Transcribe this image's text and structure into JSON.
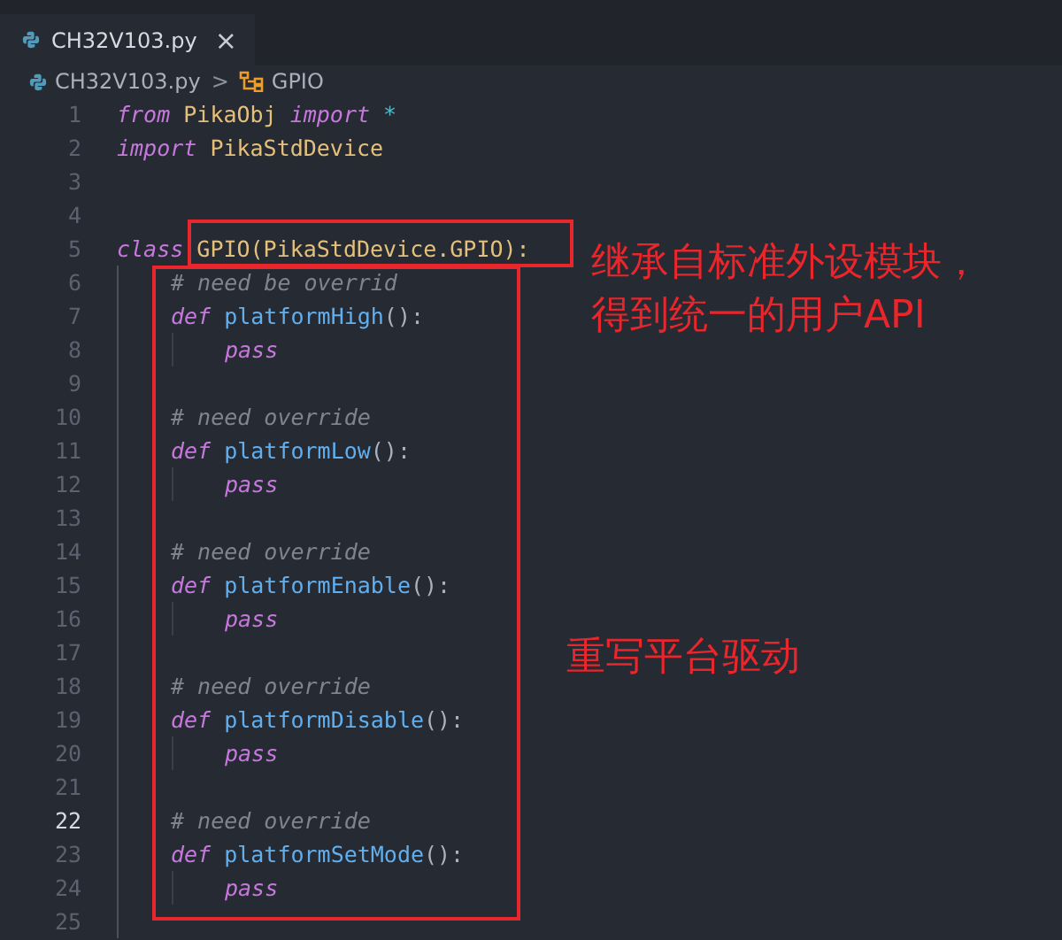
{
  "tab": {
    "label": "CH32V103.py",
    "close": "×",
    "selected": true
  },
  "breadcrumb": {
    "file": "CH32V103.py",
    "separator": ">",
    "symbol": "GPIO"
  },
  "code": [
    {
      "number": "1",
      "current": false,
      "tokens": [
        {
          "kind": "keyword",
          "text": "from"
        },
        {
          "kind": "name",
          "text": "PikaObj"
        },
        {
          "kind": "keyword",
          "text": "import"
        },
        {
          "kind": "operator",
          "text": "*"
        }
      ]
    },
    {
      "number": "2",
      "current": false,
      "tokens": [
        {
          "kind": "keyword",
          "text": "import"
        },
        {
          "kind": "name",
          "text": "PikaStdDevice"
        }
      ]
    },
    {
      "number": "3",
      "current": false
    },
    {
      "number": "4",
      "current": false
    },
    {
      "number": "5",
      "current": false,
      "tokens": [
        {
          "kind": "keyword",
          "text": "class"
        },
        {
          "kind": "name",
          "text": "GPIO(PikaStdDevice.GPIO):"
        }
      ],
      "children": [
        {
          "number": "6",
          "current": false,
          "tokens": [
            {
              "kind": "comment",
              "text": "# need be overrid"
            }
          ]
        },
        {
          "number": "7",
          "current": false,
          "tokens": [
            {
              "kind": "keyword",
              "text": "def"
            },
            {
              "kind": "function",
              "text": "platformHigh"
            },
            {
              "kind": "punct",
              "text": "():"
            }
          ],
          "children": [
            {
              "number": "8",
              "current": false,
              "tokens": [
                {
                  "kind": "keyword",
                  "text": "pass"
                }
              ]
            }
          ]
        },
        {
          "number": "9",
          "current": false
        },
        {
          "number": "10",
          "current": false,
          "tokens": [
            {
              "kind": "comment",
              "text": "# need override"
            }
          ]
        },
        {
          "number": "11",
          "current": false,
          "tokens": [
            {
              "kind": "keyword",
              "text": "def"
            },
            {
              "kind": "function",
              "text": "platformLow"
            },
            {
              "kind": "punct",
              "text": "():"
            }
          ],
          "children": [
            {
              "number": "12",
              "current": false,
              "tokens": [
                {
                  "kind": "keyword",
                  "text": "pass"
                }
              ]
            }
          ]
        },
        {
          "number": "13",
          "current": false
        },
        {
          "number": "14",
          "current": false,
          "tokens": [
            {
              "kind": "comment",
              "text": "# need override"
            }
          ]
        },
        {
          "number": "15",
          "current": false,
          "tokens": [
            {
              "kind": "keyword",
              "text": "def"
            },
            {
              "kind": "function",
              "text": "platformEnable"
            },
            {
              "kind": "punct",
              "text": "():"
            }
          ],
          "children": [
            {
              "number": "16",
              "current": false,
              "tokens": [
                {
                  "kind": "keyword",
                  "text": "pass"
                }
              ]
            }
          ]
        },
        {
          "number": "17",
          "current": false
        },
        {
          "number": "18",
          "current": false,
          "tokens": [
            {
              "kind": "comment",
              "text": "# need override"
            }
          ]
        },
        {
          "number": "19",
          "current": false,
          "tokens": [
            {
              "kind": "keyword",
              "text": "def"
            },
            {
              "kind": "function",
              "text": "platformDisable"
            },
            {
              "kind": "punct",
              "text": "():"
            }
          ],
          "children": [
            {
              "number": "20",
              "current": false,
              "tokens": [
                {
                  "kind": "keyword",
                  "text": "pass"
                }
              ]
            }
          ]
        },
        {
          "number": "21",
          "current": false
        },
        {
          "number": "22",
          "current": true,
          "tokens": [
            {
              "kind": "comment",
              "text": "# need override"
            }
          ]
        },
        {
          "number": "23",
          "current": false,
          "tokens": [
            {
              "kind": "keyword",
              "text": "def"
            },
            {
              "kind": "function",
              "text": "platformSetMode"
            },
            {
              "kind": "punct",
              "text": "():"
            }
          ],
          "children": [
            {
              "number": "24",
              "current": false,
              "tokens": [
                {
                  "kind": "keyword",
                  "text": "pass"
                }
              ]
            }
          ]
        },
        {
          "number": "25",
          "current": false
        }
      ]
    }
  ],
  "annotations": [
    {
      "kind": "note",
      "lines": [
        "继承自标准外设模块，",
        "得到统一的用户API"
      ]
    },
    {
      "kind": "note2",
      "lines": [
        "重写平台驱动"
      ]
    }
  ]
}
